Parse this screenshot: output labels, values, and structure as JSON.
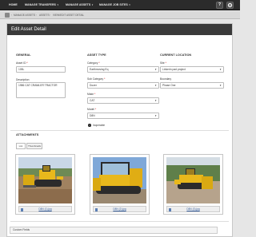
{
  "nav": {
    "items": [
      {
        "label": "HOME",
        "has_menu": false
      },
      {
        "label": "MANAGE TRANSFERS",
        "has_menu": true
      },
      {
        "label": "MANAGE ASSETS",
        "has_menu": true
      },
      {
        "label": "MANAGE JOB SITES",
        "has_menu": true
      }
    ],
    "help_label": "?",
    "settings_icon": "gear-icon"
  },
  "breadcrumb": {
    "items": [
      "MANAGE ASSETS",
      "ASSETS",
      "VIEW/EDIT ASSET DETAIL"
    ]
  },
  "page_title": "Edit Asset Detail",
  "general": {
    "heading": "GENERAL",
    "asset_id_label": "Asset ID",
    "asset_id_value": "105L",
    "description_label": "Description",
    "description_value": "1986 CAT CRAWLER TRACTOR"
  },
  "asset_type": {
    "heading": "ASSET TYPE",
    "category_label": "Category",
    "category_value": "Earthmoving Eq",
    "subcategory_label": "Sub Category",
    "subcategory_value": "Dozer",
    "make_label": "Make",
    "make_value": "CAT",
    "model_label": "Model",
    "model_value": "D8N",
    "inoperable_label": "Inoperable"
  },
  "current_location": {
    "heading": "CURRENT LOCATION",
    "site_label": "Site",
    "site_value": "Linkerin pad project",
    "boundary_label": "Boundary",
    "boundary_value": "Phase One"
  },
  "attachments": {
    "heading": "ATTACHMENTS",
    "tabs": [
      "List",
      "Thumbnails"
    ],
    "files": [
      "D8N (1).jpg",
      "D8N (2).jpg",
      "D8N (3).jpg"
    ]
  },
  "custom_fields_label": "Custom Fields",
  "colors": {
    "nav_bg": "#2b2b2b",
    "panel_header_bg": "#3a3a3a",
    "required_star": "#cc0000",
    "dozer_yellow": "#e8b81c",
    "link_blue": "#3a62a0"
  }
}
